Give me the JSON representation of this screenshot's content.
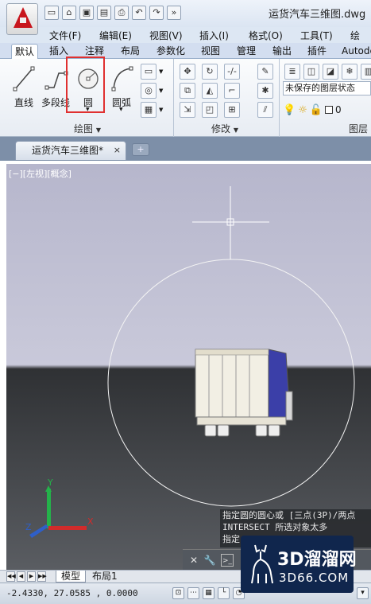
{
  "title_bar": {
    "doc_title": "运货汽车三维图.dwg"
  },
  "menu": {
    "items": [
      "文件(F)",
      "编辑(E)",
      "视图(V)",
      "插入(I)",
      "格式(O)",
      "工具(T)",
      "绘"
    ]
  },
  "ribbon_tabs": [
    "默认",
    "插入",
    "注释",
    "布局",
    "参数化",
    "视图",
    "管理",
    "输出",
    "插件",
    "Autode"
  ],
  "draw_panel": {
    "tools": [
      "直线",
      "多段线",
      "圆",
      "圆弧"
    ],
    "title": "绘图"
  },
  "modify_panel": {
    "title": "修改"
  },
  "layer_panel": {
    "state": "未保存的图层状态",
    "current_layer": "0",
    "title": "图层"
  },
  "document_tab": {
    "label": "运货汽车三维图*",
    "close": "×"
  },
  "viewport": {
    "label": "[−][左视][概念]",
    "ucs_x": "X",
    "ucs_y": "Y",
    "ucs_z": "Z",
    "sky_color": "#c3c3d6",
    "ground_color": "#3a3c40"
  },
  "command_line": {
    "line1": "指定圆的圆心或 [三点(3P)/两点",
    "line2": "INTERSECT 所选对象太多",
    "line3": "指定"
  },
  "layout_tabs": [
    "模型",
    "布局1"
  ],
  "status_bar": {
    "coords": "-2.4330, 27.0585 , 0.0000"
  },
  "watermark": {
    "main": "3D溜溜网",
    "sub": "3D66.COM"
  }
}
